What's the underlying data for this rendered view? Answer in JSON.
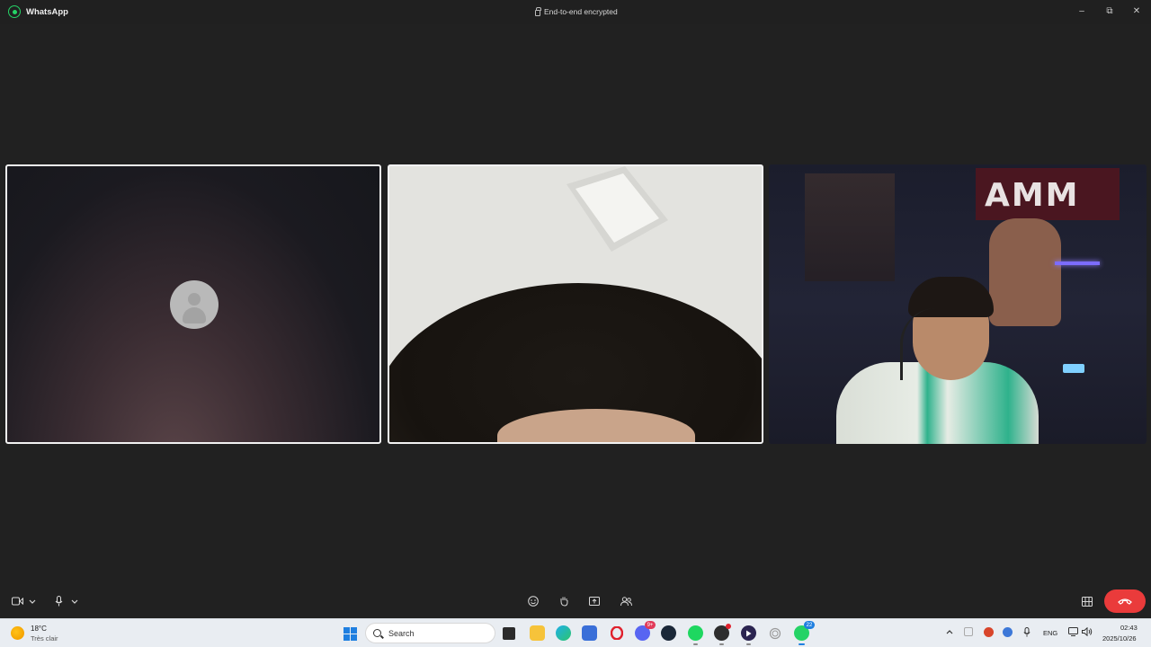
{
  "window": {
    "app_title": "WhatsApp",
    "encryption_label": "End-to-end encrypted",
    "minimize": "–",
    "maximize": "⧉",
    "close": "✕"
  },
  "call_controls": {
    "video_icon": "video-camera-icon",
    "chevron": "⌄",
    "mic_icon": "microphone-icon",
    "reactions_icon": "emoji-icon",
    "raise_hand_icon": "hand-icon",
    "share_screen_icon": "share-screen-icon",
    "add_people_icon": "people-icon",
    "layout_icon": "grid-icon",
    "end_call_icon": "phone-hangup-icon",
    "accent_end": "#ea3b3b"
  },
  "banner_text": "AMM",
  "taskbar": {
    "weather": {
      "temp": "18°C",
      "desc": "Très clair"
    },
    "search_placeholder": "Search",
    "apps": [
      {
        "name": "file-explorer"
      },
      {
        "name": "edge"
      },
      {
        "name": "store"
      },
      {
        "name": "opera"
      },
      {
        "name": "discord",
        "badge": "9+"
      },
      {
        "name": "steam"
      },
      {
        "name": "spotify"
      },
      {
        "name": "app-red-dot"
      },
      {
        "name": "media-player"
      },
      {
        "name": "app-circle"
      },
      {
        "name": "whatsapp",
        "badge": "22"
      }
    ],
    "language": "ENG",
    "time": "02:43",
    "date": "2025/10/26"
  }
}
